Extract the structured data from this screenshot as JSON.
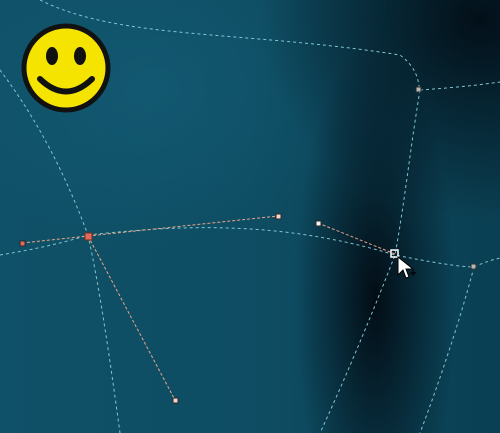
{
  "canvas": {
    "mesh_line_color": "#7fc6cf",
    "selected_path_color": "#e8a488",
    "node_handle_color": "#e06b5c",
    "background_dark": "#05131c",
    "background_teal": "#0f5168"
  },
  "icons": {
    "smiley": "smiley-face-icon",
    "cursor": "node-tool-cursor-icon"
  },
  "smiley": {
    "face_color": "#f5e400",
    "outline_color": "#111111"
  }
}
